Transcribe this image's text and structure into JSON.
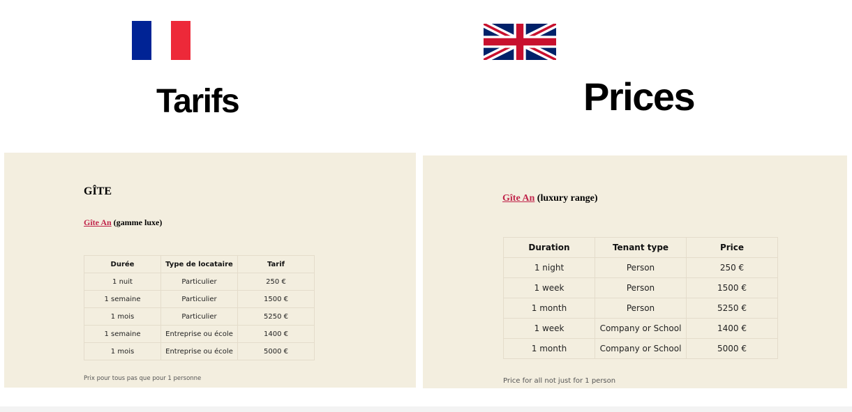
{
  "french": {
    "flag": "flag-france",
    "flag_colors": [
      "#002395",
      "#ffffff",
      "#ed2939"
    ],
    "title": "Tarifs",
    "heading": "GÎTE",
    "gite_link": "Gîte An",
    "gite_range": " (gamme luxe)",
    "table": {
      "headers": [
        "Durée",
        "Type de locataire",
        "Tarif"
      ],
      "rows": [
        [
          "1 nuit",
          "Particulier",
          "250 €"
        ],
        [
          "1 semaine",
          "Particulier",
          "1500 €"
        ],
        [
          "1 mois",
          "Particulier",
          "5250 €"
        ],
        [
          "1 semaine",
          "Entreprise ou école",
          "1400 €"
        ],
        [
          "1 mois",
          "Entreprise ou école",
          "5000 €"
        ]
      ]
    },
    "note": "Prix pour tous pas que pour 1 personne"
  },
  "english": {
    "flag": "flag-united-kingdom",
    "flag_colors": [
      "#012169",
      "#ffffff",
      "#c8102e"
    ],
    "title": "Prices",
    "gite_link": "Gîte An",
    "gite_range": " (luxury range)",
    "table": {
      "headers": [
        "Duration",
        "Tenant type",
        "Price"
      ],
      "rows": [
        [
          "1 night",
          "Person",
          "250 €"
        ],
        [
          "1 week",
          "Person",
          "1500 €"
        ],
        [
          "1 month",
          "Person",
          "5250 €"
        ],
        [
          "1 week",
          "Company or School",
          "1400 €"
        ],
        [
          "1 month",
          "Company or School",
          "5000 €"
        ]
      ]
    },
    "note": "Price for all not just for 1 person"
  },
  "colors": {
    "panel_background": "#f3eedf",
    "link": "#c0244a",
    "table_border": "#e4dccb"
  }
}
